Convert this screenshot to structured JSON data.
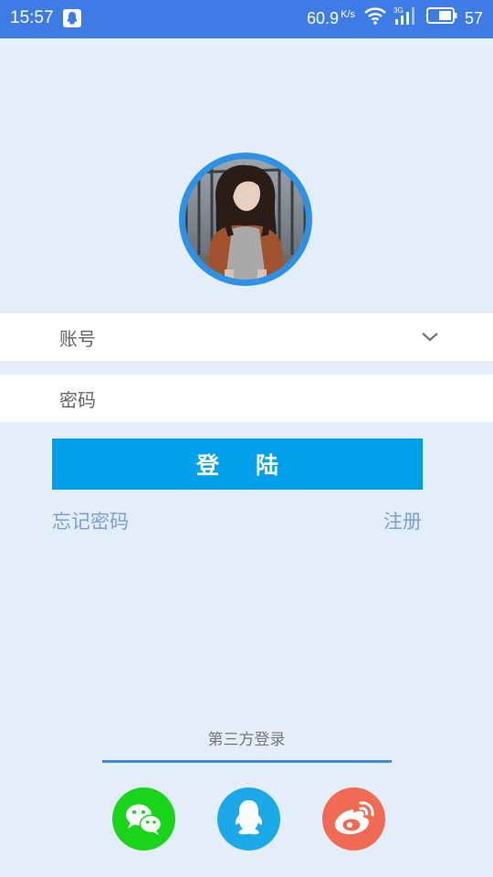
{
  "status_bar": {
    "time": "15:57",
    "net_speed": "60.9",
    "net_speed_unit": "K/s",
    "battery": "57",
    "icons": [
      "qq-notification-icon",
      "wifi-icon",
      "signal-3g-icon",
      "battery-icon"
    ]
  },
  "login": {
    "account_placeholder": "账号",
    "password_placeholder": "密码",
    "login_button": "登陆",
    "forgot_password": "忘记密码",
    "register": "注册"
  },
  "third_party": {
    "title": "第三方登录",
    "providers": [
      "wechat",
      "qq",
      "weibo"
    ]
  },
  "colors": {
    "status_bar": "#3d7ce4",
    "background": "#e4eef8",
    "primary_button": "#00a1ea",
    "link": "#7b9fd8",
    "wechat": "#1ad41b",
    "qq": "#1ba9e9",
    "weibo": "#f16a53"
  }
}
